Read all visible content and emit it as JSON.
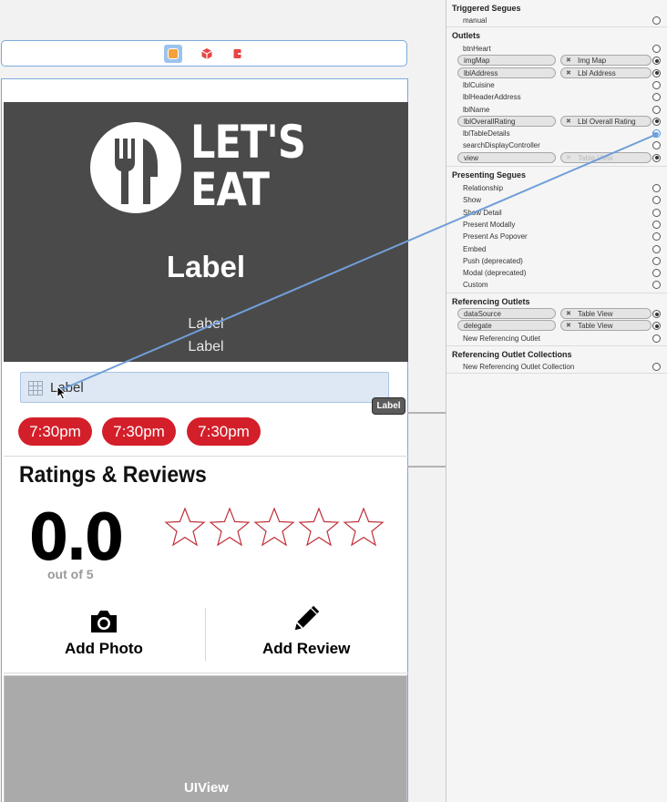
{
  "canvas": {
    "header": {
      "logo_line1": "LET'S",
      "logo_line2": "EAT",
      "title": "Label",
      "subtitle1": "Label",
      "subtitle2": "Label"
    },
    "cell_label": "Label",
    "label_tag": "Label",
    "times": [
      "7:30pm",
      "7:30pm",
      "7:30pm"
    ],
    "ratings_title": "Ratings & Reviews",
    "rating_value": "0.0",
    "rating_out_of": "out of 5",
    "stars": 5,
    "stars_filled": 0,
    "add_photo": "Add Photo",
    "add_review": "Add Review",
    "uiview_label": "UIView"
  },
  "inspector": {
    "triggered_segues": {
      "title": "Triggered Segues",
      "rows": [
        {
          "name": "manual"
        }
      ]
    },
    "outlets": {
      "title": "Outlets",
      "rows": [
        {
          "name": "btnHeart"
        },
        {
          "name": "imgMap",
          "target": "Img Map"
        },
        {
          "name": "lblAddress",
          "target": "Lbl Address"
        },
        {
          "name": "lblCuisine"
        },
        {
          "name": "lblHeaderAddress"
        },
        {
          "name": "lblName"
        },
        {
          "name": "lblOverallRating",
          "target": "Lbl Overall Rating"
        },
        {
          "name": "lblTableDetails"
        },
        {
          "name": "searchDisplayController"
        },
        {
          "name": "view",
          "target": "Table View"
        }
      ]
    },
    "presenting_segues": {
      "title": "Presenting Segues",
      "rows": [
        {
          "name": "Relationship"
        },
        {
          "name": "Show"
        },
        {
          "name": "Show Detail"
        },
        {
          "name": "Present Modally"
        },
        {
          "name": "Present As Popover"
        },
        {
          "name": "Embed"
        },
        {
          "name": "Push (deprecated)"
        },
        {
          "name": "Modal (deprecated)"
        },
        {
          "name": "Custom"
        }
      ]
    },
    "referencing_outlets": {
      "title": "Referencing Outlets",
      "rows": [
        {
          "name": "dataSource",
          "target": "Table View"
        },
        {
          "name": "delegate",
          "target": "Table View"
        },
        {
          "name": "New Referencing Outlet"
        }
      ]
    },
    "referencing_outlet_collections": {
      "title": "Referencing Outlet Collections",
      "rows": [
        {
          "name": "New Referencing Outlet Collection"
        }
      ]
    }
  },
  "colors": {
    "accent_red": "#d31f2a",
    "header_bg": "#4a4a4a",
    "selection_blue": "#7da9dc",
    "uiview_gray": "#aaaaaa"
  }
}
